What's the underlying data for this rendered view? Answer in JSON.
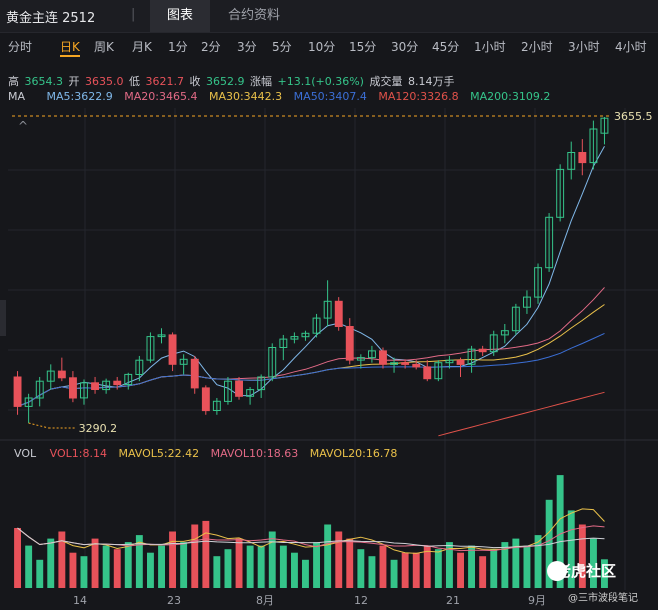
{
  "header": {
    "instrument": "黄金主连 2512",
    "separator": "|",
    "tabs": [
      {
        "label": "图表",
        "active": true
      },
      {
        "label": "合约资料",
        "active": false
      }
    ]
  },
  "periods": [
    "分时",
    "日K",
    "周K",
    "月K",
    "1分",
    "2分",
    "3分",
    "5分",
    "10分",
    "15分",
    "30分",
    "45分",
    "1小时",
    "2小时",
    "3小时",
    "4小时"
  ],
  "active_period": "日K",
  "ohlc": {
    "high_label": "高",
    "high": "3654.3",
    "open_label": "开",
    "open": "3635.0",
    "low_label": "低",
    "low": "3621.7",
    "close_label": "收",
    "close": "3652.9",
    "change_label": "涨幅",
    "change": "+13.1(+0.36%)",
    "volume_label": "成交量",
    "volume": "8.14万手"
  },
  "ma": {
    "label": "MA",
    "ma5": "MA5:3622.9",
    "ma20": "MA20:3465.4",
    "ma30": "MA30:3442.3",
    "ma50": "MA50:3407.4",
    "ma120": "MA120:3326.8",
    "ma200": "MA200:3109.2"
  },
  "vol": {
    "label": "VOL",
    "vol1": "VOL1:8.14",
    "mavol5": "MAVOL5:22.42",
    "mavol10": "MAVOL10:18.63",
    "mavol20": "MAVOL20:16.78"
  },
  "price_markers": {
    "last": "3655.5",
    "low_marker": "3290.2"
  },
  "x_labels": [
    "14",
    "23",
    "8月",
    "12",
    "21",
    "9月"
  ],
  "colors": {
    "up": "#35c48a",
    "down": "#e8525a",
    "accent": "#f5a623",
    "ma5": "#7fb7e8",
    "ma20": "#e26a86",
    "ma30": "#e9c04a",
    "ma50": "#3b6fd6",
    "ma120": "#e0524a",
    "ma200": "#e0524a"
  },
  "watermark": {
    "brand": "老虎社区",
    "sub": "@三市波段笔记"
  },
  "chart_data": {
    "type": "candlestick",
    "candles": [
      {
        "o": 3345,
        "h": 3352,
        "l": 3300,
        "c": 3310
      },
      {
        "o": 3310,
        "h": 3325,
        "l": 3290,
        "c": 3320
      },
      {
        "o": 3320,
        "h": 3345,
        "l": 3310,
        "c": 3340
      },
      {
        "o": 3340,
        "h": 3360,
        "l": 3330,
        "c": 3352
      },
      {
        "o": 3352,
        "h": 3368,
        "l": 3340,
        "c": 3344
      },
      {
        "o": 3344,
        "h": 3352,
        "l": 3315,
        "c": 3320
      },
      {
        "o": 3320,
        "h": 3342,
        "l": 3312,
        "c": 3338
      },
      {
        "o": 3338,
        "h": 3345,
        "l": 3325,
        "c": 3330
      },
      {
        "o": 3330,
        "h": 3343,
        "l": 3325,
        "c": 3340
      },
      {
        "o": 3340,
        "h": 3345,
        "l": 3330,
        "c": 3336
      },
      {
        "o": 3336,
        "h": 3350,
        "l": 3330,
        "c": 3348
      },
      {
        "o": 3348,
        "h": 3370,
        "l": 3340,
        "c": 3365
      },
      {
        "o": 3365,
        "h": 3398,
        "l": 3362,
        "c": 3393
      },
      {
        "o": 3393,
        "h": 3403,
        "l": 3385,
        "c": 3395
      },
      {
        "o": 3395,
        "h": 3398,
        "l": 3352,
        "c": 3360
      },
      {
        "o": 3360,
        "h": 3372,
        "l": 3348,
        "c": 3366
      },
      {
        "o": 3366,
        "h": 3370,
        "l": 3325,
        "c": 3332
      },
      {
        "o": 3332,
        "h": 3335,
        "l": 3300,
        "c": 3305
      },
      {
        "o": 3305,
        "h": 3320,
        "l": 3300,
        "c": 3316
      },
      {
        "o": 3316,
        "h": 3345,
        "l": 3312,
        "c": 3340
      },
      {
        "o": 3340,
        "h": 3345,
        "l": 3318,
        "c": 3322
      },
      {
        "o": 3322,
        "h": 3333,
        "l": 3312,
        "c": 3330
      },
      {
        "o": 3330,
        "h": 3348,
        "l": 3320,
        "c": 3345
      },
      {
        "o": 3345,
        "h": 3385,
        "l": 3340,
        "c": 3380
      },
      {
        "o": 3380,
        "h": 3395,
        "l": 3365,
        "c": 3390
      },
      {
        "o": 3390,
        "h": 3398,
        "l": 3385,
        "c": 3393
      },
      {
        "o": 3393,
        "h": 3400,
        "l": 3388,
        "c": 3397
      },
      {
        "o": 3397,
        "h": 3420,
        "l": 3392,
        "c": 3415
      },
      {
        "o": 3415,
        "h": 3460,
        "l": 3405,
        "c": 3435
      },
      {
        "o": 3435,
        "h": 3440,
        "l": 3400,
        "c": 3405
      },
      {
        "o": 3405,
        "h": 3415,
        "l": 3360,
        "c": 3365
      },
      {
        "o": 3365,
        "h": 3372,
        "l": 3355,
        "c": 3368
      },
      {
        "o": 3368,
        "h": 3382,
        "l": 3362,
        "c": 3376
      },
      {
        "o": 3376,
        "h": 3380,
        "l": 3355,
        "c": 3360
      },
      {
        "o": 3360,
        "h": 3368,
        "l": 3350,
        "c": 3362
      },
      {
        "o": 3362,
        "h": 3366,
        "l": 3355,
        "c": 3360
      },
      {
        "o": 3360,
        "h": 3365,
        "l": 3354,
        "c": 3357
      },
      {
        "o": 3357,
        "h": 3365,
        "l": 3340,
        "c": 3343
      },
      {
        "o": 3343,
        "h": 3365,
        "l": 3340,
        "c": 3362
      },
      {
        "o": 3362,
        "h": 3370,
        "l": 3355,
        "c": 3365
      },
      {
        "o": 3365,
        "h": 3368,
        "l": 3345,
        "c": 3360
      },
      {
        "o": 3360,
        "h": 3382,
        "l": 3350,
        "c": 3378
      },
      {
        "o": 3378,
        "h": 3382,
        "l": 3370,
        "c": 3375
      },
      {
        "o": 3375,
        "h": 3400,
        "l": 3370,
        "c": 3395
      },
      {
        "o": 3395,
        "h": 3408,
        "l": 3385,
        "c": 3400
      },
      {
        "o": 3400,
        "h": 3432,
        "l": 3395,
        "c": 3428
      },
      {
        "o": 3428,
        "h": 3448,
        "l": 3420,
        "c": 3440
      },
      {
        "o": 3440,
        "h": 3480,
        "l": 3432,
        "c": 3475
      },
      {
        "o": 3475,
        "h": 3540,
        "l": 3470,
        "c": 3535
      },
      {
        "o": 3535,
        "h": 3598,
        "l": 3530,
        "c": 3592
      },
      {
        "o": 3592,
        "h": 3625,
        "l": 3580,
        "c": 3612
      },
      {
        "o": 3612,
        "h": 3628,
        "l": 3585,
        "c": 3600
      },
      {
        "o": 3600,
        "h": 3650,
        "l": 3592,
        "c": 3640
      },
      {
        "o": 3635,
        "h": 3654.3,
        "l": 3621.7,
        "c": 3652.9
      }
    ],
    "volume": [
      17,
      12,
      8,
      14,
      16,
      10,
      9,
      14,
      12,
      11,
      13,
      15,
      10,
      12,
      16,
      13,
      18,
      19,
      9,
      11,
      14,
      12,
      12,
      16,
      12,
      10,
      8,
      13,
      18,
      16,
      14,
      11,
      9,
      12,
      8,
      10,
      10,
      12,
      11,
      13,
      10,
      12,
      9,
      11,
      13,
      14,
      12,
      15,
      25,
      32,
      22,
      18,
      14,
      8.14
    ],
    "ylim": [
      3270,
      3665
    ]
  }
}
